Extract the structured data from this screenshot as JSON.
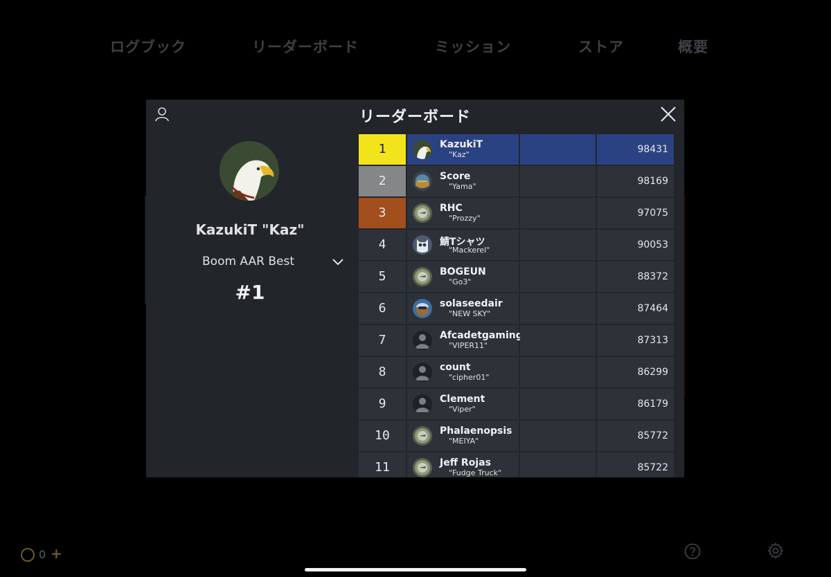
{
  "nav": {
    "items": [
      {
        "label": "ログブック"
      },
      {
        "label": "リーダーボード"
      },
      {
        "label": "ミッション"
      },
      {
        "label": "ストア"
      },
      {
        "label": "概要"
      }
    ]
  },
  "modal": {
    "title": "リーダーボード",
    "icons": {
      "user": "user-icon",
      "close": "close-icon"
    }
  },
  "profile": {
    "name": "KazukiT \"Kaz\"",
    "board": "Boom AAR Best",
    "rank": "#1",
    "avatar": "eagle-avatar"
  },
  "leaderboard": {
    "rank_colors": {
      "1": "#f2e41b",
      "2": "#858688",
      "3": "#a34e1d"
    },
    "self_color": "#2b4282",
    "rows": [
      {
        "rank": "1",
        "name": "KazukiT",
        "callsign": "\"Kaz\"",
        "score": "98431",
        "avatar": "eagle"
      },
      {
        "rank": "2",
        "name": "Score",
        "callsign": "\"Yama\"",
        "score": "98169",
        "avatar": "instrument"
      },
      {
        "rank": "3",
        "name": "RHC",
        "callsign": "\"Prozzy\"",
        "score": "97075",
        "avatar": "badge"
      },
      {
        "rank": "4",
        "name": "鯖Tシャツ",
        "callsign": "\"Mackerel\"",
        "score": "90053",
        "avatar": "owl"
      },
      {
        "rank": "5",
        "name": "BOGEUN",
        "callsign": "\"Go3\"",
        "score": "88372",
        "avatar": "badge"
      },
      {
        "rank": "6",
        "name": "solaseedair",
        "callsign": "\"NEW SKY\"",
        "score": "87464",
        "avatar": "pilot"
      },
      {
        "rank": "7",
        "name": "Afcadetgaming",
        "callsign": "\"VIPER11\"",
        "score": "87313",
        "avatar": "default"
      },
      {
        "rank": "8",
        "name": "count",
        "callsign": "\"cipher01\"",
        "score": "86299",
        "avatar": "default"
      },
      {
        "rank": "9",
        "name": "Clement",
        "callsign": "\"Viper\"",
        "score": "86179",
        "avatar": "default"
      },
      {
        "rank": "10",
        "name": "Phalaenopsis",
        "callsign": "\"MEIYA\"",
        "score": "85772",
        "avatar": "badge"
      },
      {
        "rank": "11",
        "name": "Jeff Rojas",
        "callsign": "\"Fudge Truck\"",
        "score": "85722",
        "avatar": "badge"
      }
    ]
  },
  "footer": {
    "coins": "0",
    "plus": "+",
    "icons": {
      "coin": "coin-icon",
      "help": "help-icon",
      "settings": "gear-icon"
    }
  }
}
